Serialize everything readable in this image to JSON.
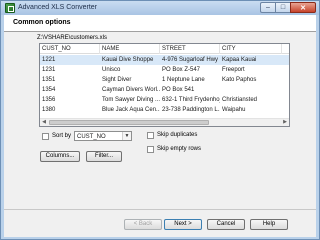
{
  "window": {
    "title": "Advanced XLS Converter",
    "buttons": {
      "minimize": "–",
      "maximize": "□",
      "close": "✕"
    },
    "icons": {
      "app": "spreadsheet-icon"
    }
  },
  "header": {
    "title": "Common options"
  },
  "file_path": "Z:\\VSHARE\\customers.xls",
  "table": {
    "columns": [
      "CUST_NO",
      "NAME",
      "STREET",
      "CITY"
    ],
    "rows": [
      [
        "1221",
        "Kauai Dive Shoppe",
        "4-976 Sugarloaf Hwy",
        "Kapaa Kauai"
      ],
      [
        "1231",
        "Unisco",
        "PO Box Z-547",
        "Freeport"
      ],
      [
        "1351",
        "Sight Diver",
        "1 Neptune Lane",
        "Kato Paphos"
      ],
      [
        "1354",
        "Cayman Divers Worl...",
        "PO Box 541",
        ""
      ],
      [
        "1356",
        "Tom Sawyer Diving ...",
        "632-1 Third Frydenhoj",
        "Christiansted"
      ],
      [
        "1380",
        "Blue Jack Aqua Cen...",
        "23-738 Paddington L...",
        "Waipahu"
      ]
    ]
  },
  "sort": {
    "label": "Sort by",
    "checked": false,
    "selected": "CUST_NO"
  },
  "options": {
    "skip_duplicates": {
      "label": "Skip duplicates",
      "checked": false
    },
    "skip_empty_rows": {
      "label": "Skip empty rows",
      "checked": false
    }
  },
  "buttons": {
    "columns": "Columns...",
    "filter": "Filter...",
    "back": "< Back",
    "next": "Next >",
    "cancel": "Cancel",
    "help": "Help"
  },
  "colors": {
    "titlebar": "#b9d1ea",
    "close": "#c7432a",
    "selection": "#d8e8f8"
  }
}
